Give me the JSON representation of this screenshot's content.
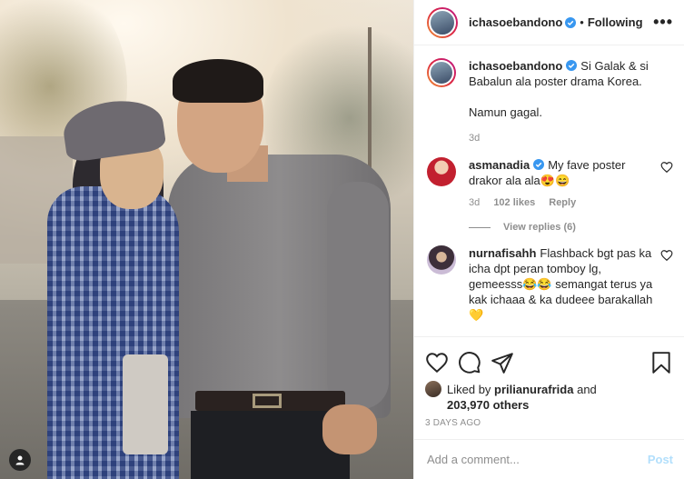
{
  "post": {
    "username": "ichasoebandono",
    "following_label": "Following",
    "more_label": "•••",
    "caption_lines": [
      "Si Galak & si",
      "Babalun ala poster drama Korea."
    ],
    "caption_extra": "Namun gagal.",
    "caption_time": "3d"
  },
  "comments": [
    {
      "username": "asmanadia",
      "text": "My fave poster drakor ala ala😍😄",
      "time": "3d",
      "likes": "102 likes",
      "reply": "Reply",
      "view_replies": "View replies (6)"
    },
    {
      "username": "nurnafisahh",
      "text": "Flashback bgt pas ka icha dpt peran tomboy lg, gemeesss😂😂 semangat terus ya kak ichaaa & ka dudeee barakallah💛"
    }
  ],
  "likes": {
    "prefix": "Liked by",
    "user": "prilianurafrida",
    "and": "and",
    "count": "203,970 others"
  },
  "time_ago": "3 DAYS AGO",
  "comment_box": {
    "placeholder": "Add a comment...",
    "post_label": "Post"
  },
  "colors": {
    "verified": "#3897f0",
    "post_disabled": "#b2dffc",
    "muted": "#8e8e8e"
  },
  "icons": [
    "heart-icon",
    "comment-icon",
    "share-icon",
    "bookmark-icon",
    "user-tag-icon",
    "verified-icon"
  ]
}
